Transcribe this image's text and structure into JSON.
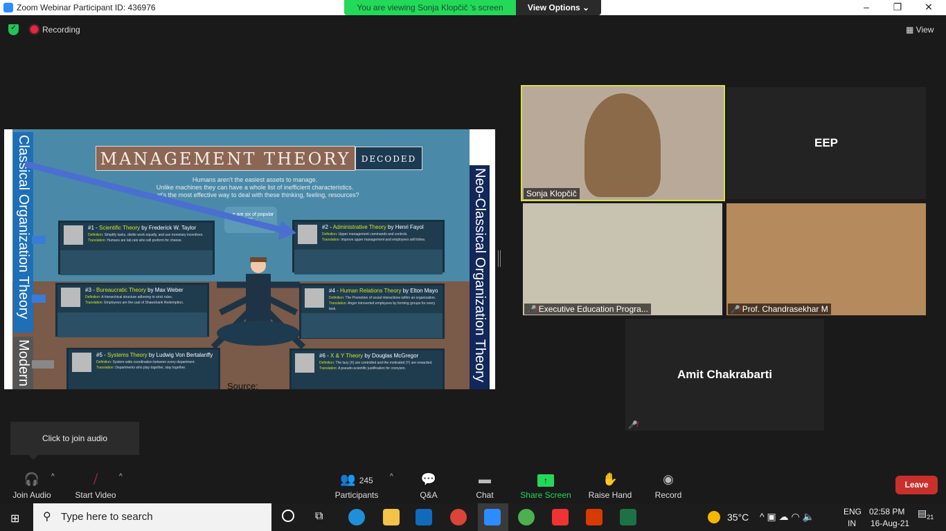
{
  "window": {
    "title": "Zoom Webinar Participant ID: 436976",
    "controls": [
      "–",
      "❐",
      "✕"
    ]
  },
  "banner": {
    "viewing": "You are viewing Sonja Klopčič 's screen",
    "view_options": "View Options ⌄"
  },
  "topbar": {
    "recording": "Recording",
    "view": "View"
  },
  "slide": {
    "title": "MANAGEMENT THEORY",
    "badge": "DECODED",
    "classical": "Classical Organization Theory",
    "neo": "Neo-Classical Organization Theory",
    "modern": "Modern",
    "intro": [
      "Humans aren't the easiest assets to manage.",
      "Unlike machines they can have a whole  list of inefficient characteristics.",
      "…at's the most effective way to deal with these thinking, feeling, resources?"
    ],
    "bubble": "…e are six of popular thec…",
    "source": "Source:",
    "cards": [
      {
        "num": "#1 - ",
        "name": "Scientific Theory",
        "by": " by Frederick W. Taylor",
        "def": "Simplify tasks, divide work equally, and use monetary incentives.",
        "tr": "Humans are lab rats who will preform for cheese."
      },
      {
        "num": "#2 - ",
        "name": "Administrative Theory",
        "by": " by Henri Fayol",
        "def": "Upper management commands and controls.",
        "tr": "Improve upper management and employees will follow."
      },
      {
        "num": "#3 - ",
        "name": "Bureaucratic Theory",
        "by": " by Max Weber",
        "def": "A hierarchical structure adhering to strict rules.",
        "tr": "Employees are the cast of  Shawshank Redemption."
      },
      {
        "num": "#4 - ",
        "name": "Human Relations Theory",
        "by": " by Elton Mayo",
        "def": "The Promotion of social interactions within an organization.",
        "tr": "Anger introverted employees by forming groups for every task."
      },
      {
        "num": "#5 - ",
        "name": "Systems Theory",
        "by": " by Ludwig Von Bertalanffy",
        "def": "System-wide coordination between every department.",
        "tr": "Departments who play together, stay together."
      },
      {
        "num": "#6 - ",
        "name": "X & Y Theory",
        "by": " by Douglas McGregor",
        "def": "The lazy (X) are controlled and the motivated (Y) are rewarded.",
        "tr": "A pseudo-scientific justification for cronyism."
      }
    ],
    "def_label": "Definition: ",
    "tr_label": "Translation: "
  },
  "videos": {
    "sonja": "Sonja Klopčič",
    "eep": "EEP",
    "exec": "Executive Education Progra...",
    "prof": "Prof. Chandrasekhar M",
    "amit": "Amit Chakrabarti"
  },
  "tooltip": "Click to join audio",
  "toolbar": {
    "join_audio": "Join Audio",
    "start_video": "Start Video",
    "participants": "Participants",
    "participant_count": "245",
    "qa": "Q&A",
    "chat": "Chat",
    "share": "Share Screen",
    "raise": "Raise Hand",
    "record": "Record",
    "leave": "Leave",
    "share_color": "#23d959"
  },
  "taskbar": {
    "search": "Type here to search",
    "temp": "35°C",
    "lang1": "ENG",
    "lang2": "IN",
    "time": "02:58 PM",
    "date": "16-Aug-21",
    "notif": "21"
  }
}
